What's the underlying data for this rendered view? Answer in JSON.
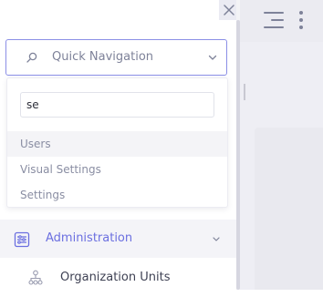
{
  "quick_navigation": {
    "placeholder": "Quick Navigation",
    "search_value": "se",
    "results": [
      "Users",
      "Visual Settings",
      "Settings"
    ]
  },
  "menu": {
    "administration_label": "Administration",
    "organization_units_label": "Organization Units"
  },
  "icons": {
    "close": "close-icon",
    "search": "search-icon",
    "chevron": "chevron-down-icon",
    "administration": "administration-icon",
    "organization_units": "organization-units-icon",
    "menu_toggle": "hamburger-icon",
    "more": "kebab-icon"
  },
  "colors": {
    "accent": "#6b6fe0",
    "border_focus": "#8b8fe6"
  }
}
